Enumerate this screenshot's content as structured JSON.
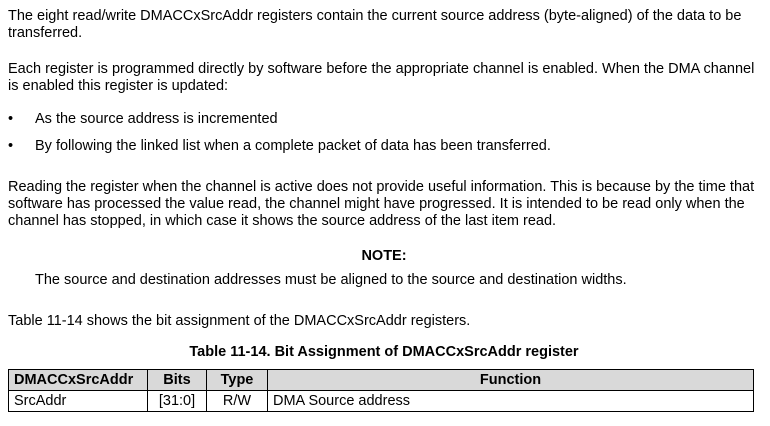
{
  "paragraphs": {
    "intro": "The eight read/write DMACCxSrcAddr registers contain the current source address (byte-aligned) of the data to be transferred.",
    "programmed": "Each register is programmed directly by software before the appropriate channel is enabled. When the DMA channel is enabled this register is updated:",
    "reading": "Reading the register when the channel is active does not provide useful information. This is because by the time that software has processed the value read, the channel might have progressed. It is intended to be read only when the channel has stopped, in which case it shows the source address of the last item read.",
    "table_ref": "Table 11-14 shows the bit assignment of the DMACCxSrcAddr registers."
  },
  "bullets": [
    "As the source address is incremented",
    "By following the linked list when a complete packet of data has been transferred."
  ],
  "bullet_symbol": "•",
  "note": {
    "heading": "NOTE:",
    "text": "The source and destination addresses must be aligned to the source and destination widths."
  },
  "table": {
    "caption": "Table 11-14. Bit Assignment of DMACCxSrcAddr register",
    "header_bg": "#d9d9d9",
    "columns": [
      "DMACCxSrcAddr",
      "Bits",
      "Type",
      "Function"
    ],
    "rows": [
      [
        "SrcAddr",
        "[31:0]",
        "R/W",
        "DMA Source address"
      ]
    ]
  }
}
